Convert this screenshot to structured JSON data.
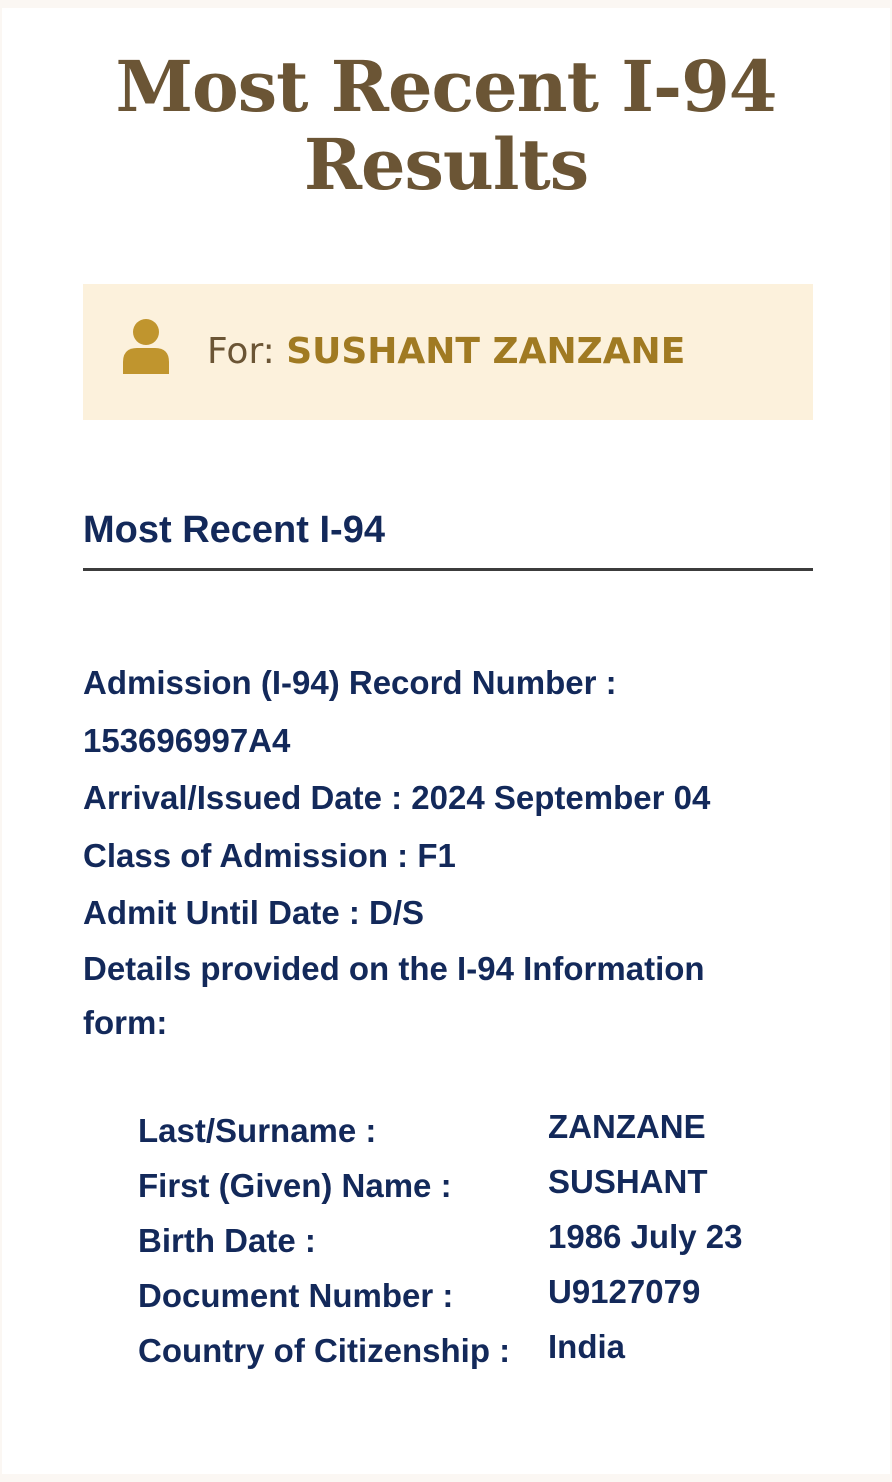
{
  "header": {
    "title_line1": "Most Recent I-94",
    "title_line2": "Results"
  },
  "for_banner": {
    "icon": "person-icon",
    "prefix": "For: ",
    "name": "SUSHANT ZANZANE",
    "name_color": "#a07a22",
    "background": "#fcf1dc"
  },
  "section": {
    "heading": "Most Recent I-94"
  },
  "record": {
    "record_number_label": "Admission (I-94) Record Number :",
    "record_number_value": "153696997A4",
    "arrival_label": "Arrival/Issued Date :",
    "arrival_value": "2024 September 04",
    "class_label": "Class of Admission :",
    "class_value": "F1",
    "admit_until_label": "Admit Until Date :",
    "admit_until_value": "D/S",
    "details_intro": "Details provided on the I-94 Information form:"
  },
  "form_details": [
    {
      "label": "Last/Surname :",
      "value": "ZANZANE"
    },
    {
      "label": "First (Given) Name :",
      "value": "SUSHANT"
    },
    {
      "label": "Birth Date :",
      "value": "1986 July 23"
    },
    {
      "label": "Document Number :",
      "value": "U9127079"
    },
    {
      "label": "Country of Citizenship :",
      "value": "India"
    }
  ],
  "colors": {
    "title": "#6b5535",
    "text": "#13295a",
    "icon": "#c0952e"
  }
}
